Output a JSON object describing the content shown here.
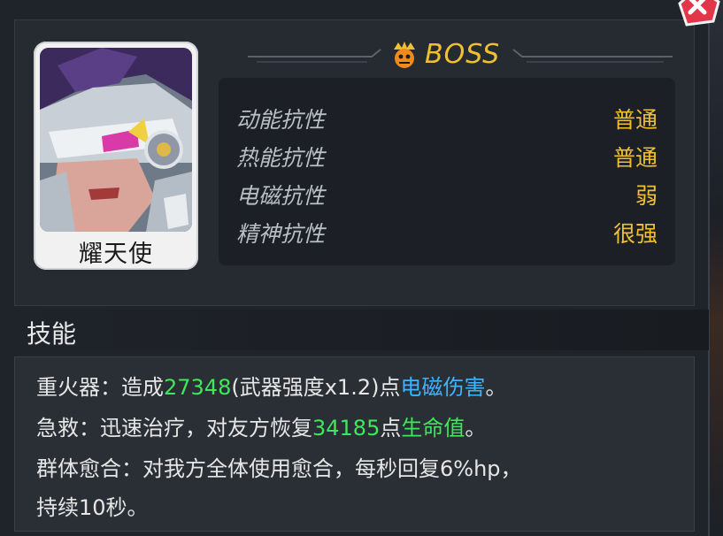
{
  "character": {
    "name": "耀天使",
    "tier_label": "BOSS",
    "tier_icon": "boss-crown-icon"
  },
  "resistances": [
    {
      "label": "动能抗性",
      "value": "普通"
    },
    {
      "label": "热能抗性",
      "value": "普通"
    },
    {
      "label": "电磁抗性",
      "value": "弱"
    },
    {
      "label": "精神抗性",
      "value": "很强"
    }
  ],
  "skills": {
    "title": "技能",
    "lines": [
      {
        "parts": [
          "重火器：造成",
          "27348",
          "(武器强度x1.2)点",
          "电磁伤害",
          "。"
        ]
      },
      {
        "parts": [
          "急救：迅速治疗，对友方恢复",
          "34185",
          "点",
          "生命值",
          "。"
        ]
      },
      {
        "parts": [
          "群体愈合：对我方全体使用愈合，每秒回复6%hp，"
        ]
      },
      {
        "parts": [
          "持续10秒。"
        ]
      }
    ]
  },
  "colors": {
    "accent_gold": "#f0c030",
    "number_green": "#3ee85a",
    "damage_blue": "#3fb4ff",
    "close_red": "#e2364a"
  }
}
